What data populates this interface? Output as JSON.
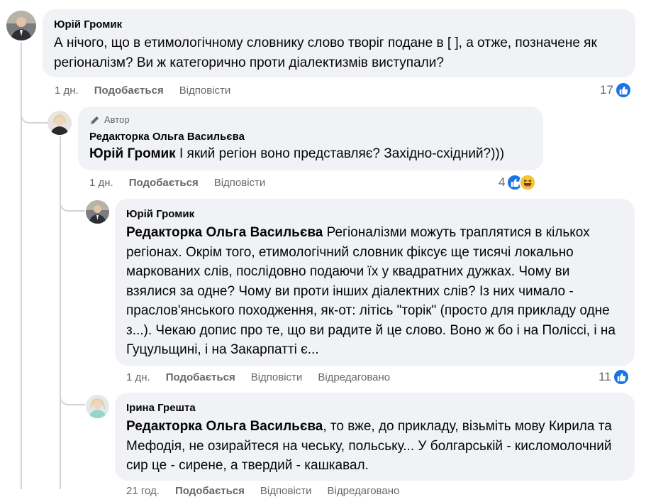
{
  "comments": [
    {
      "author": "Юрій Громик",
      "mention": "",
      "text": "А нічого, що в етимологічному словнику слово творіг подане в [ ], а отже, позначене як регіоналізм? Ви ж категорично проти діалектизмів виступали?",
      "time": "1 дн.",
      "like": "Подобається",
      "reply": "Відповісти",
      "reaction_count": "17"
    },
    {
      "badge": "Автор",
      "author": "Редакторка Ольга Васильєва",
      "mention": "Юрій Громик",
      "text": "І який регіон воно представляє? Західно-східний?)))",
      "time": "1 дн.",
      "like": "Подобається",
      "reply": "Відповісти",
      "reaction_count": "4"
    },
    {
      "author": "Юрій Громик",
      "mention": "Редакторка Ольга Васильєва",
      "text": "Регіоналізми можуть траплятися в кількох регіонах. Окрім того, етимологічний словник фіксує ще тисячі локально маркованих слів, послідовно подаючи їх у квадратних дужках. Чому ви взялися за одне? Чому ви проти інших діалектних слів? Із них чимало - праслов'янського походження, як-от: літісь \"торік\" (просто для прикладу одне з...). Чекаю допис про те, що ви радите й це слово. Воно ж бо і на Поліссі, і на Гуцульщині, і на Закарпатті є...",
      "time": "1 дн.",
      "like": "Подобається",
      "reply": "Відповісти",
      "edited": "Відредаговано",
      "reaction_count": "11"
    },
    {
      "author": "Ірина Грешта",
      "mention": "Редакторка Ольга Васильєва",
      "text": ", то вже, до прикладу, візьміть мову Кирила та Мефодія, не озирайтеся на чеську, польську... У болгарській - кисломолочний сир це - сирене, а твердий - кашкавал.",
      "time": "21 год.",
      "like": "Подобається",
      "reply": "Відповісти",
      "edited": "Відредаговано"
    }
  ],
  "colors": {
    "bubble": "#f0f2f5",
    "like_blue": "#1b74e4",
    "meta_gray": "#65676b",
    "thread_line": "#d0d3d8"
  }
}
